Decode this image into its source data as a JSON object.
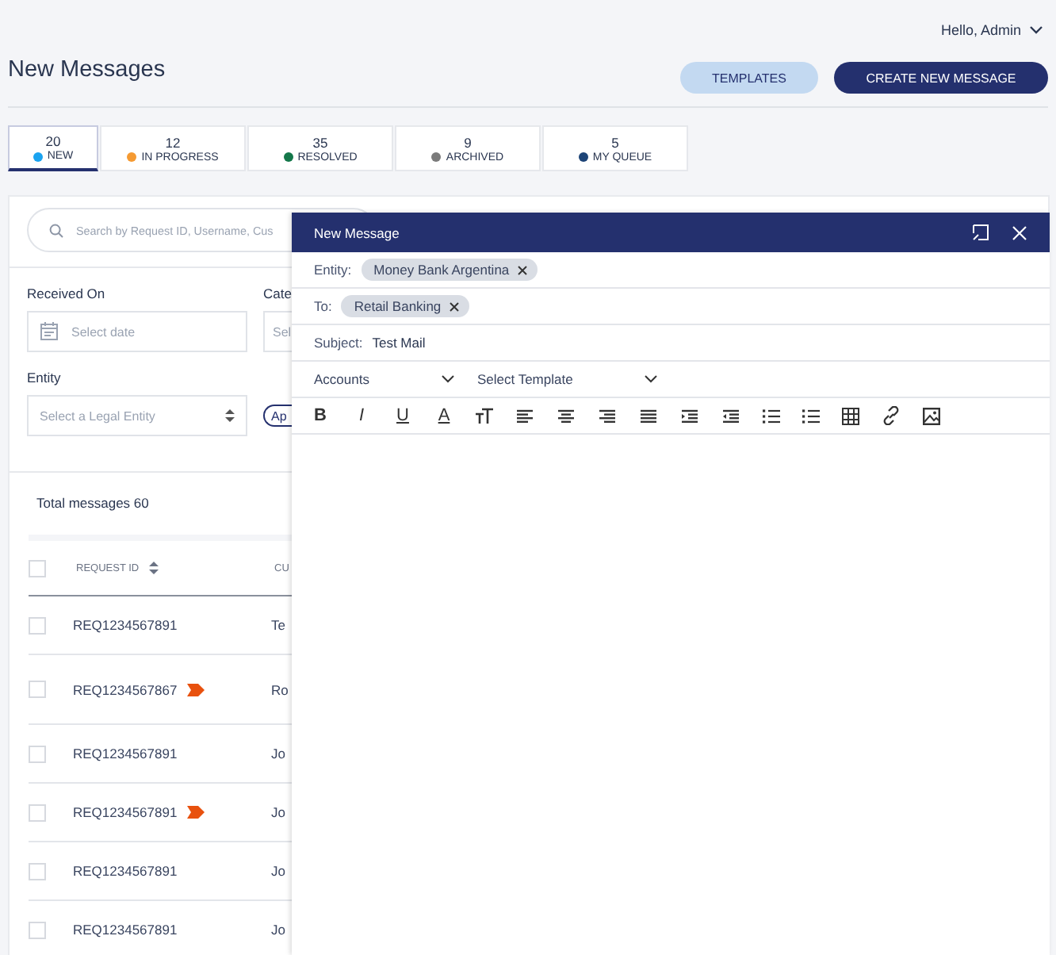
{
  "user_menu": {
    "label": "Hello, Admin"
  },
  "page_title": "New Messages",
  "buttons": [
    {
      "label": "TEMPLATES",
      "kind": "secondary"
    },
    {
      "label": "CREATE NEW MESSAGE",
      "kind": "primary"
    }
  ],
  "tabs": [
    {
      "count": "20",
      "label": "NEW",
      "color": "#1aa3f0",
      "selected": true
    },
    {
      "count": "12",
      "label": "IN PROGRESS",
      "color": "#f59a32",
      "selected": false
    },
    {
      "count": "35",
      "label": "RESOLVED",
      "color": "#14774a",
      "selected": false
    },
    {
      "count": "9",
      "label": "ARCHIVED",
      "color": "#7b7b7b",
      "selected": false
    },
    {
      "count": "5",
      "label": "MY QUEUE",
      "color": "#1d4477",
      "selected": false
    }
  ],
  "filters": {
    "search_placeholder": "Search by Request ID, Username, Cus",
    "received_on": {
      "label": "Received On",
      "placeholder": "Select date"
    },
    "category": {
      "label": "Cate",
      "placeholder": "Sel"
    },
    "entity": {
      "label": "Entity",
      "placeholder": "Select a Legal Entity"
    },
    "apply_button": "Ap"
  },
  "table": {
    "total": "Total messages 60",
    "select_all_checked": false,
    "columns": [
      "REQUEST ID",
      "CU"
    ],
    "rows": [
      {
        "request_id": "REQ1234567891",
        "column_2": "Te",
        "flagged": false,
        "checked": false
      },
      {
        "request_id": "REQ1234567867",
        "column_2": "Ro",
        "flagged": true,
        "checked": false
      },
      {
        "request_id": "REQ1234567891",
        "column_2": "Jo",
        "flagged": false,
        "checked": false
      },
      {
        "request_id": "REQ1234567891",
        "column_2": "Jo",
        "flagged": true,
        "checked": false
      },
      {
        "request_id": "REQ1234567891",
        "column_2": "Jo",
        "flagged": false,
        "checked": false
      },
      {
        "request_id": "REQ1234567891",
        "column_2": "Jo",
        "flagged": false,
        "checked": false
      }
    ]
  },
  "compose": {
    "title": "New Message",
    "entity": {
      "label": "Entity:",
      "chips": [
        "Money Bank Argentina"
      ]
    },
    "to": {
      "label": "To:",
      "chips": [
        "Retail Banking"
      ]
    },
    "subject": {
      "label": "Subject:",
      "value": "Test Mail"
    },
    "dropdowns": [
      "Accounts",
      "Select Template"
    ],
    "toolbar": [
      {
        "kind": "bold",
        "glyph": "B"
      },
      {
        "kind": "italic",
        "glyph": "I"
      },
      {
        "kind": "underline",
        "glyph": "U"
      },
      {
        "kind": "color",
        "glyph": "A"
      },
      {
        "kind": "size"
      },
      {
        "kind": "align-left"
      },
      {
        "kind": "align-center"
      },
      {
        "kind": "align-right"
      },
      {
        "kind": "justify"
      },
      {
        "kind": "indent"
      },
      {
        "kind": "outdent"
      },
      {
        "kind": "bullets"
      },
      {
        "kind": "numbers"
      },
      {
        "kind": "table"
      },
      {
        "kind": "link"
      },
      {
        "kind": "image"
      }
    ]
  }
}
